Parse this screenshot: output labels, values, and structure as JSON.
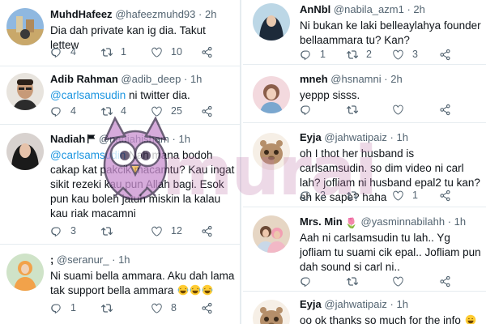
{
  "left_column": {
    "tweets": [
      {
        "name": "MuhdHafeez",
        "handle": "@hafeezmuhd93",
        "time": "2h",
        "text": "Dia dah private kan ig dia. Takut lettew",
        "replies": "4",
        "retweets": "1",
        "likes": "10"
      },
      {
        "name": "Adib Rahman",
        "handle": "@adib_deep",
        "time": "1h",
        "mention": "@carlsamsudin",
        "text": " ni twitter dia.",
        "replies": "4",
        "retweets": "4",
        "likes": "25"
      },
      {
        "name": "Nadiah",
        "handle": "@nadiahisham",
        "time": "1h",
        "mention": "@carlsamsudin",
        "text": " Nah mana bodoh cakap kat pakcik macamtu? Kau ingat sikit rezeki kau pun Allah bagi. Esok pun kau boleh jatuh miskin la kalau kau riak macamni",
        "replies": "3",
        "retweets": "",
        "likes": "12"
      },
      {
        "name": ";",
        "handle": "@seranur_",
        "time": "1h",
        "text": "Ni suami bella ammara. Aku dah lama tak support bella ammara",
        "replies": "1",
        "retweets": "",
        "likes": "8"
      }
    ]
  },
  "right_column": {
    "tweets": [
      {
        "name": "AnNbl",
        "handle": "@nabila_azm1",
        "time": "2h",
        "text": "Ni bukan ke laki belleaylahya founder bellaammara tu?  Kan?",
        "replies": "1",
        "retweets": "2",
        "likes": "3"
      },
      {
        "name": "mneh",
        "handle": "@hsnamni",
        "time": "2h",
        "text": "yeppp sisss.",
        "replies": "",
        "retweets": "",
        "likes": ""
      },
      {
        "name": "Eyja",
        "handle": "@jahwatipaiz",
        "time": "1h",
        "text": "oh I thot her husband is carlsamsudin. so dim video ni carl lah? jofliam ni husband epal2 tu kan? eh ke sape? haha",
        "replies": "2",
        "retweets": "",
        "likes": "1"
      },
      {
        "name": "Mrs. Min",
        "handle": "@yasminnabilahh",
        "time": "1h",
        "text": "Aah ni carlsamsudin tu lah.. Yg jofliam tu suami cik epal.. Jofliam pun dah sound si carl ni..",
        "replies": "",
        "retweets": "",
        "likes": ""
      },
      {
        "name": "Eyja",
        "handle": "@jahwatipaiz",
        "time": "1h",
        "text": "oo ok thanks so much for the info",
        "replies": "",
        "retweets": "",
        "likes": ""
      }
    ]
  },
  "watermark": {
    "text": "murai"
  },
  "icons": {
    "reply": "reply-icon",
    "retweet": "retweet-icon",
    "like": "heart-icon",
    "share": "share-icon"
  },
  "colors": {
    "text": "#0f1419",
    "secondary": "#536471",
    "link": "#1b95e0",
    "divider": "#e6ecf0",
    "watermark": "#be78aa"
  }
}
